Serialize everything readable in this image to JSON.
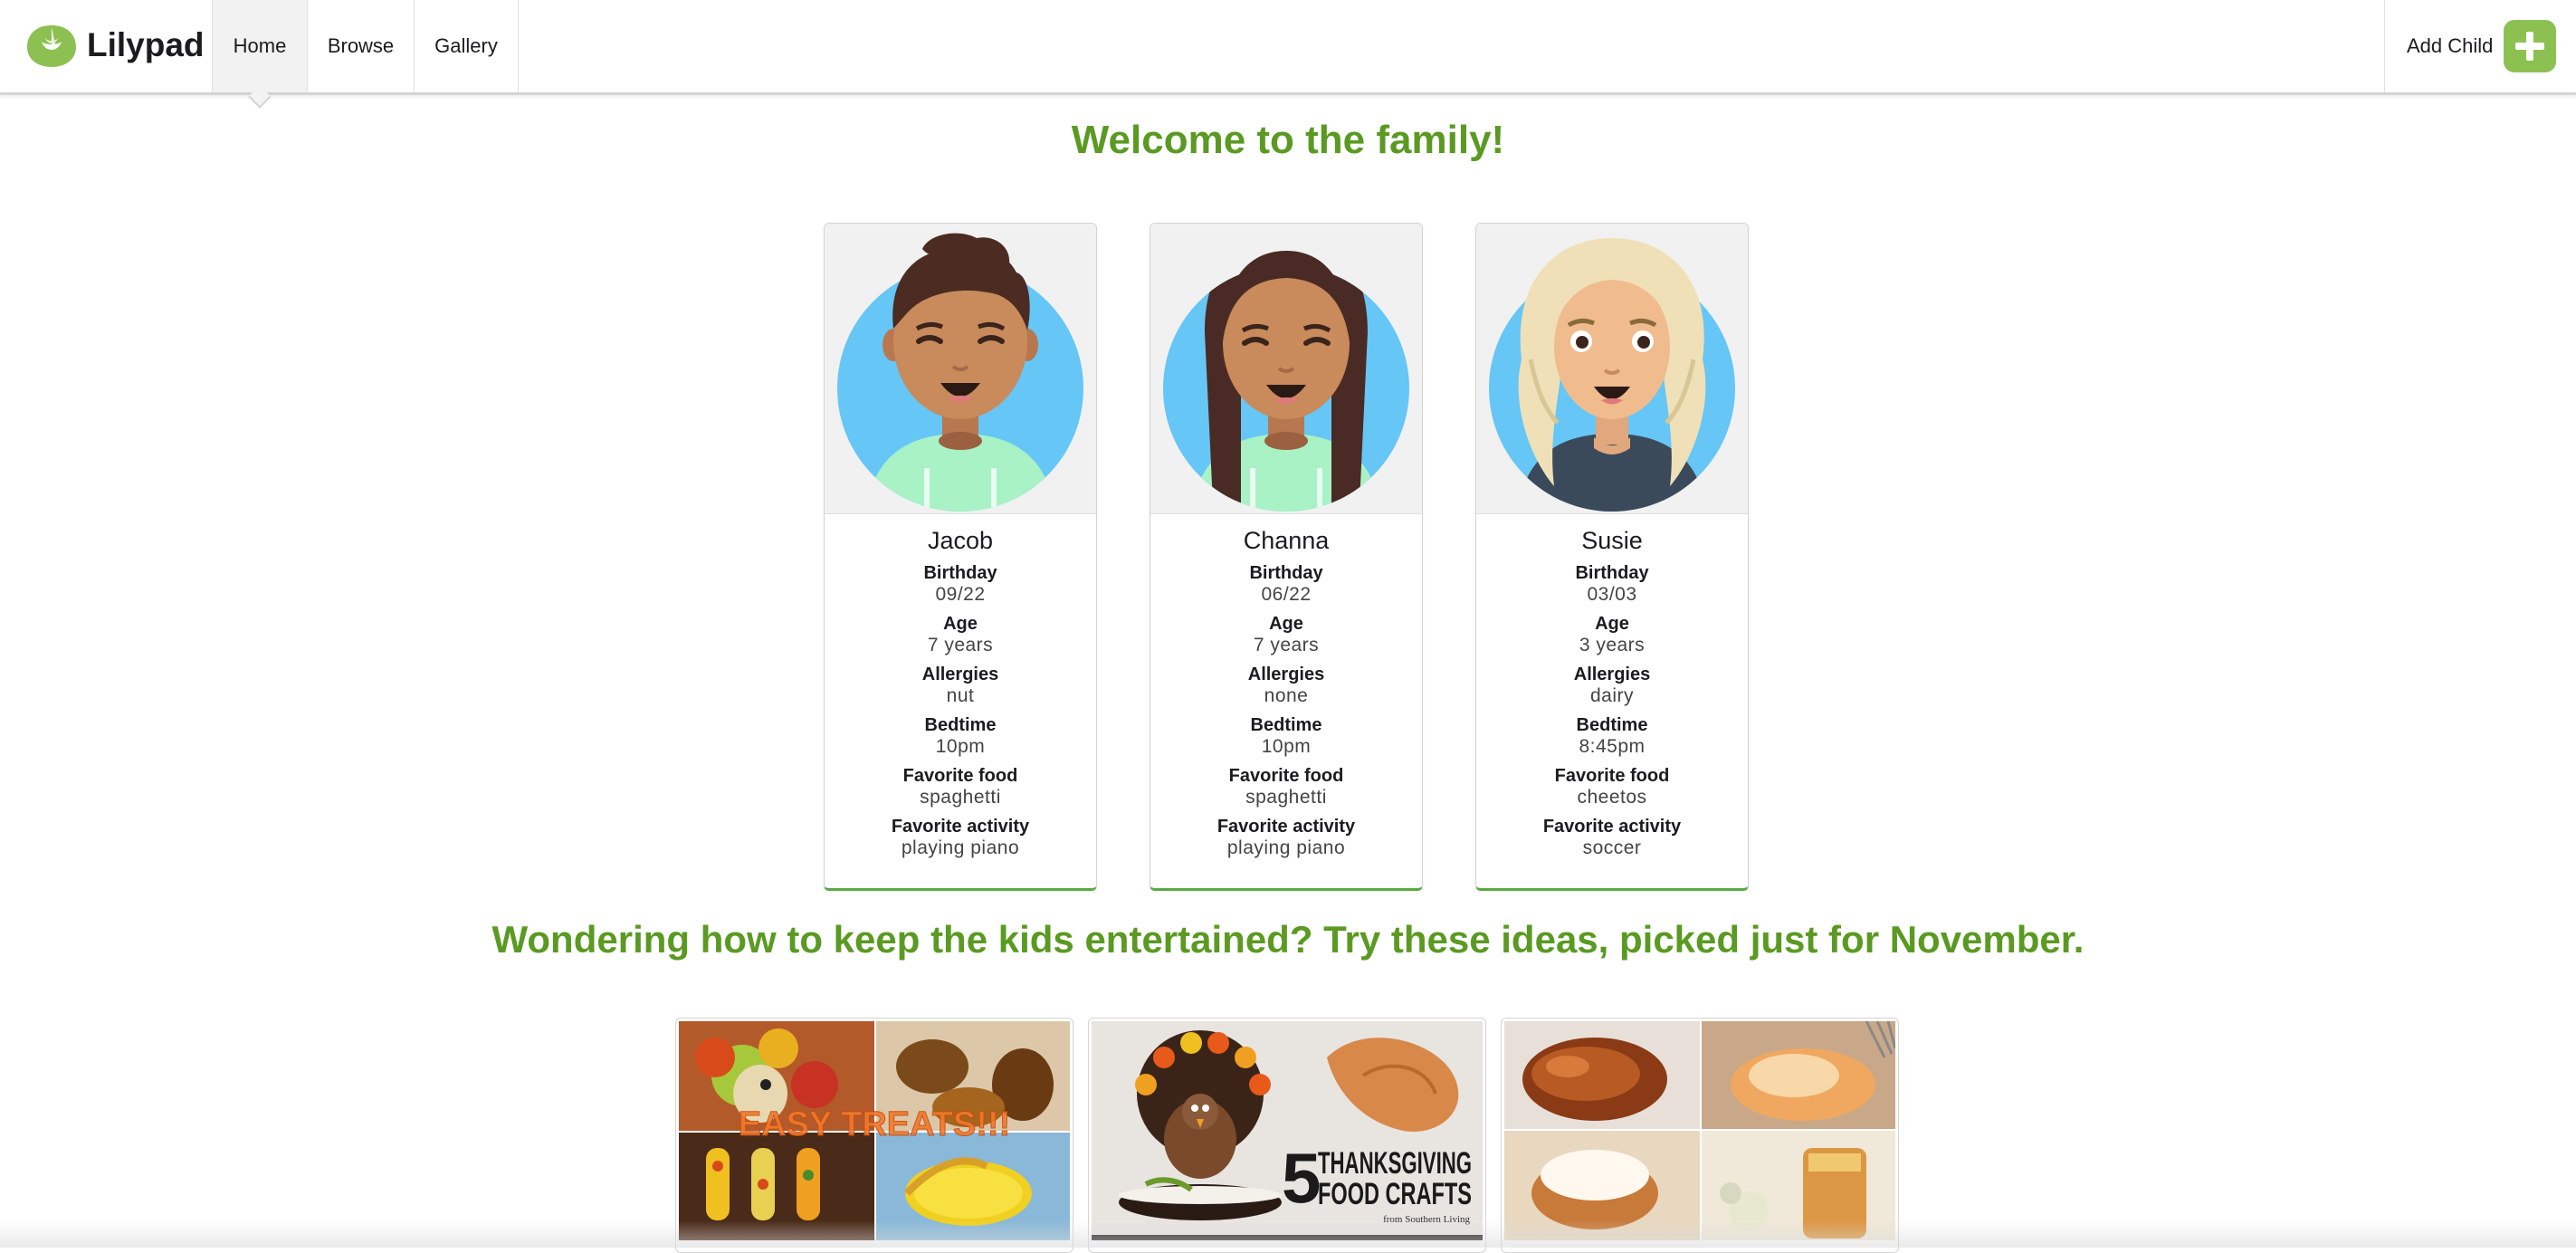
{
  "app": {
    "name": "Lilypad",
    "logo_icon": "lily-pad-logo-icon"
  },
  "nav": {
    "items": [
      {
        "label": "Home",
        "active": true
      },
      {
        "label": "Browse",
        "active": false
      },
      {
        "label": "Gallery",
        "active": false
      }
    ],
    "add_child_label": "Add Child",
    "add_child_icon": "plus-icon"
  },
  "welcome_heading": "Welcome to the family!",
  "children": [
    {
      "name": "Jacob",
      "fields": [
        {
          "label": "Birthday",
          "value": "09/22"
        },
        {
          "label": "Age",
          "value": "7 years"
        },
        {
          "label": "Allergies",
          "value": "nut"
        },
        {
          "label": "Bedtime",
          "value": "10pm"
        },
        {
          "label": "Favorite food",
          "value": "spaghetti"
        },
        {
          "label": "Favorite activity",
          "value": "playing piano"
        }
      ]
    },
    {
      "name": "Channa",
      "fields": [
        {
          "label": "Birthday",
          "value": "06/22"
        },
        {
          "label": "Age",
          "value": "7 years"
        },
        {
          "label": "Allergies",
          "value": "none"
        },
        {
          "label": "Bedtime",
          "value": "10pm"
        },
        {
          "label": "Favorite food",
          "value": "spaghetti"
        },
        {
          "label": "Favorite activity",
          "value": "playing piano"
        }
      ]
    },
    {
      "name": "Susie",
      "fields": [
        {
          "label": "Birthday",
          "value": "03/03"
        },
        {
          "label": "Age",
          "value": "3 years"
        },
        {
          "label": "Allergies",
          "value": "dairy"
        },
        {
          "label": "Bedtime",
          "value": "8:45pm"
        },
        {
          "label": "Favorite food",
          "value": "cheetos"
        },
        {
          "label": "Favorite activity",
          "value": "soccer"
        }
      ]
    }
  ],
  "ideas_heading": "Wondering how to keep the kids entertained? Try these ideas, picked just for November.",
  "ideas": [
    {
      "overlay_text": "EASY TREATS!!!"
    },
    {
      "overlay_number": "5",
      "overlay_line1": "THANKSGIVING",
      "overlay_line2": "FOOD CRAFTS",
      "overlay_credit": "from Southern Living"
    },
    {}
  ],
  "colors": {
    "accent_green": "#5a9a22",
    "button_green": "#8cc152",
    "avatar_bg": "#66c6f6"
  }
}
